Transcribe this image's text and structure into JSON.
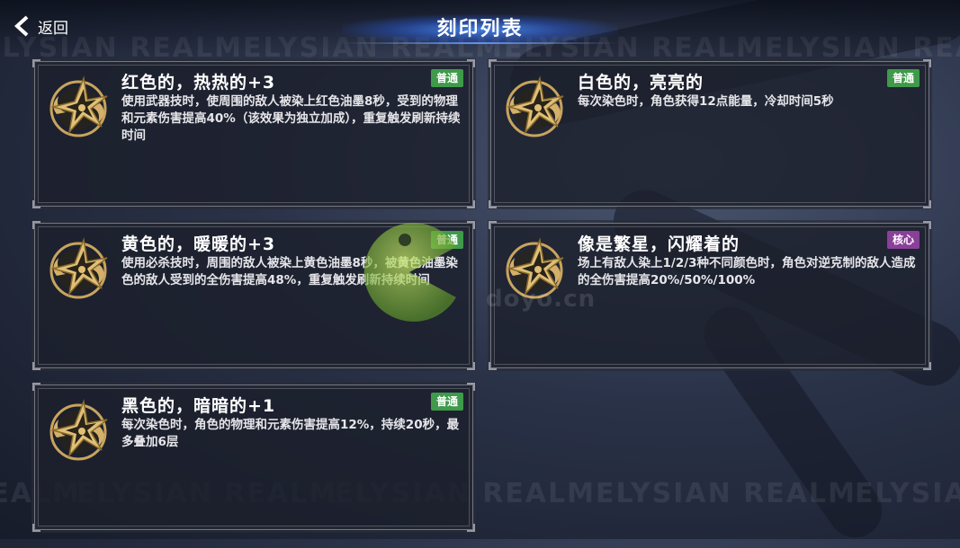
{
  "header": {
    "back_label": "返回",
    "title": "刻印列表"
  },
  "background": {
    "watermark_text": "ELYSIAN REALM"
  },
  "colors": {
    "badge_normal": "#3f9a4a",
    "badge_core": "#8a3f9a",
    "title_glow": "#3d7dff"
  },
  "cards": [
    {
      "title": "红色的，热热的+3",
      "badge": "普通",
      "badge_type": "normal",
      "icon": "golden-star-emblem-icon",
      "desc": "使用武器技时，使周围的敌人被染上红色油墨8秒，受到的物理和元素伤害提高40%（该效果为独立加成），重复触发刷新持续时间"
    },
    {
      "title": "白色的，亮亮的",
      "badge": "普通",
      "badge_type": "normal",
      "icon": "golden-star-emblem-icon",
      "desc": "每次染色时，角色获得12点能量，冷却时间5秒"
    },
    {
      "title": "黄色的，暖暖的+3",
      "badge": "普通",
      "badge_type": "normal",
      "icon": "golden-star-emblem-icon",
      "desc": "使用必杀技时，周围的敌人被染上黄色油墨8秒，被黄色油墨染色的敌人受到的全伤害提高48%，重复触发刷新持续时间"
    },
    {
      "title": "像是繁星，闪耀着的",
      "badge": "核心",
      "badge_type": "core",
      "icon": "golden-star-emblem-icon",
      "desc": "场上有敌人染上1/2/3种不同颜色时，角色对逆克制的敌人造成的全伤害提高20%/50%/100%"
    },
    {
      "title": "黑色的，暗暗的+1",
      "badge": "普通",
      "badge_type": "normal",
      "icon": "golden-star-emblem-icon",
      "desc": "每次染色时，角色的物理和元素伤害提高12%，持续20秒，最多叠加6层"
    }
  ],
  "overlay": {
    "site_text": "doyo.cn"
  }
}
